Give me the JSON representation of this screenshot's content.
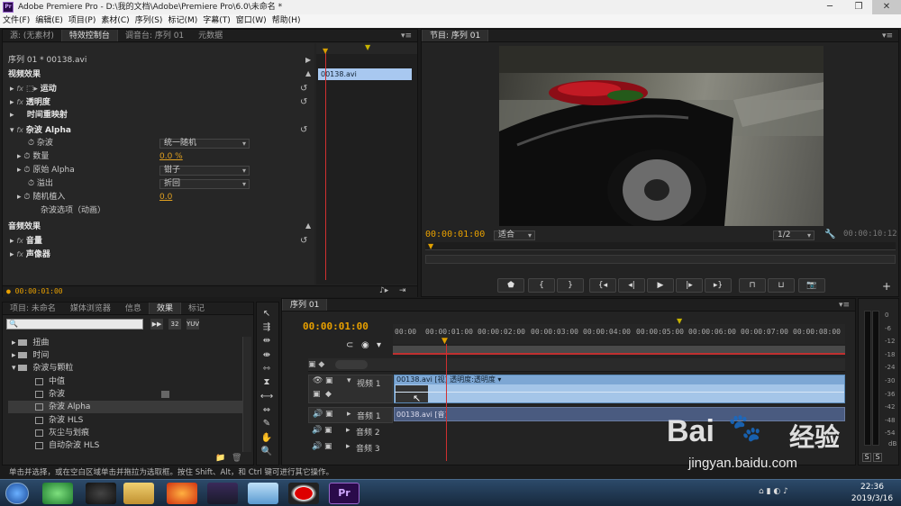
{
  "window": {
    "title": "Adobe Premiere Pro - D:\\我的文档\\Adobe\\Premiere Pro\\6.0\\未命名 *",
    "app_icon": "Pr"
  },
  "menu": [
    "文件(F)",
    "编辑(E)",
    "项目(P)",
    "素材(C)",
    "序列(S)",
    "标记(M)",
    "字幕(T)",
    "窗口(W)",
    "帮助(H)"
  ],
  "top_left_panel": {
    "tabs": [
      "源: (无素材)",
      "特效控制台",
      "调音台: 序列 01",
      "元数据"
    ],
    "active_tab": "特效控制台",
    "sequence_label": "序列 01 * 00138.avi",
    "clip_label": "00138.avi",
    "video_effects_header": "视频效果",
    "effects": [
      "运动",
      "透明度",
      "时间重映射"
    ],
    "noise_alpha": {
      "name": "杂波 Alpha",
      "params": [
        {
          "name": "杂波",
          "value": "统一随机"
        },
        {
          "name": "数量",
          "value": "0.0 %"
        },
        {
          "name": "原始 Alpha",
          "value": "钳子"
        },
        {
          "name": "溢出",
          "value": "折回"
        },
        {
          "name": "随机植入",
          "value": "0.0"
        },
        {
          "name": "杂波选项（动画）",
          "value": ""
        }
      ]
    },
    "audio_effects_header": "音频效果",
    "audio_effects": [
      "音量",
      "声像器"
    ],
    "timecode": "00:00:01:00"
  },
  "program_monitor": {
    "tab": "节目: 序列 01",
    "timecode": "00:00:01:00",
    "fit": "适合",
    "resolution": "1/2",
    "duration": "00:00:10:12",
    "controls": [
      "marker-icon",
      "in-point-icon",
      "out-point-icon",
      "go-to-in-icon",
      "step-back-icon",
      "play-icon",
      "step-forward-icon",
      "go-to-out-icon",
      "lift-icon",
      "extract-icon",
      "export-frame-icon"
    ]
  },
  "bottom_left_panel": {
    "tabs": [
      "项目: 未命名",
      "媒体浏览器",
      "信息",
      "效果",
      "标记"
    ],
    "active_tab": "效果",
    "tree": [
      {
        "label": "扭曲",
        "type": "folder",
        "level": 1
      },
      {
        "label": "时间",
        "type": "folder",
        "level": 1
      },
      {
        "label": "杂波与颗粒",
        "type": "folder",
        "level": 1,
        "open": true
      },
      {
        "label": "中值",
        "type": "effect",
        "level": 2
      },
      {
        "label": "杂波",
        "type": "effect",
        "level": 2
      },
      {
        "label": "杂波 Alpha",
        "type": "effect",
        "level": 2,
        "selected": true
      },
      {
        "label": "杂波 HLS",
        "type": "effect",
        "level": 2
      },
      {
        "label": "灰尘与划痕",
        "type": "effect",
        "level": 2
      },
      {
        "label": "自动杂波 HLS",
        "type": "effect",
        "level": 2
      }
    ]
  },
  "timeline": {
    "tab": "序列 01",
    "timecode": "00:00:01:00",
    "ruler": [
      "00:00",
      "00:00:01:00",
      "00:00:02:00",
      "00:00:03:00",
      "00:00:04:00",
      "00:00:05:00",
      "00:00:06:00",
      "00:00:07:00",
      "00:00:08:00"
    ],
    "tracks": {
      "video1": "视频 1",
      "audio1": "音频 1",
      "audio2": "音频 2",
      "audio3": "音频 3"
    },
    "video_clip": "00138.avi [视] 透明度:透明度 ▾",
    "audio_clip": "00138.avi [音]"
  },
  "audio_meter": {
    "labels": [
      "0",
      "-6",
      "-12",
      "-18",
      "-24",
      "-30",
      "-36",
      "-42",
      "-48",
      "-54",
      "dB"
    ],
    "solo": [
      "S",
      "S"
    ]
  },
  "status_bar": "单击并选择，或在空白区域单击并拖拉为选取框。按住 Shift、Alt，和 Ctrl 键可进行其它操作。",
  "watermark": {
    "brand": "Bai",
    "brand2": "经验",
    "url": "jingyan.baidu.com"
  },
  "taskbar": {
    "time": "22:36",
    "date": "2019/3/16"
  }
}
